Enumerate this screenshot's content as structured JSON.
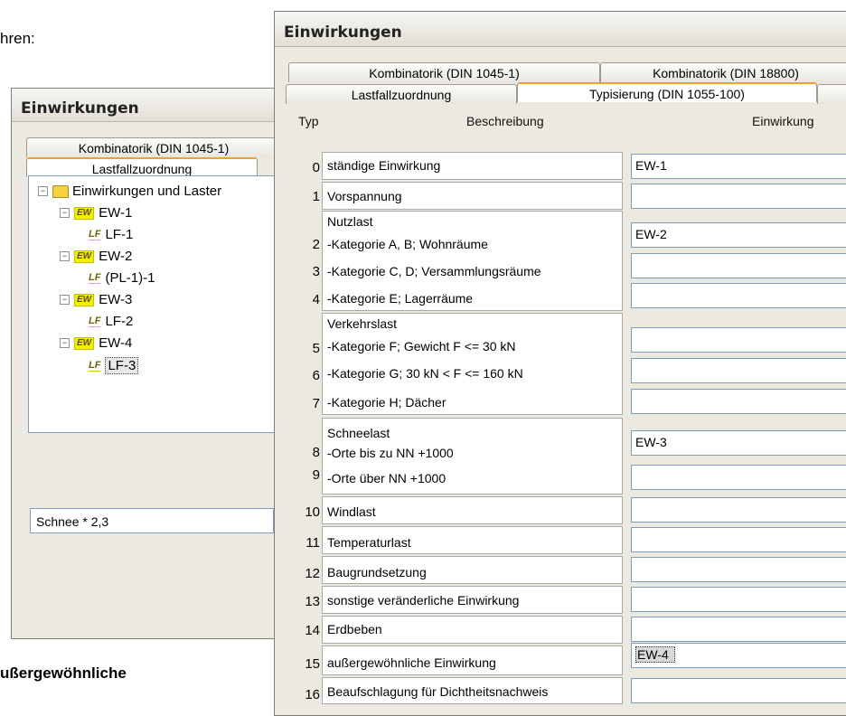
{
  "doc_fragments": {
    "top": "hren:",
    "bottom": "ußergewöhnliche"
  },
  "back_window": {
    "title": "Einwirkungen",
    "tabs": {
      "row1": "Kombinatorik (DIN 1045-1)",
      "row2": "Lastfallzuordnung"
    },
    "tree": {
      "root": "Einwirkungen und Laster",
      "nodes": [
        {
          "label": "EW-1",
          "children": [
            "LF-1"
          ]
        },
        {
          "label": "EW-2",
          "children": [
            "(PL-1)-1"
          ]
        },
        {
          "label": "EW-3",
          "children": [
            "LF-2"
          ]
        },
        {
          "label": "EW-4",
          "children": [
            "LF-3"
          ]
        }
      ],
      "icon_ew": "EW",
      "icon_lf": "LF"
    },
    "formula_input": "Schnee * 2,3"
  },
  "front_window": {
    "title": "Einwirkungen",
    "tabs": {
      "row1": [
        "Kombinatorik (DIN 1045-1)",
        "Kombinatorik (DIN 18800)"
      ],
      "row2": [
        "Lastfallzuordnung",
        "Typisierung (DIN 1055-100)"
      ]
    },
    "headers": {
      "typ": "Typ",
      "beschreibung": "Beschreibung",
      "einwirkung": "Einwirkung"
    },
    "rows": [
      {
        "typ": "0",
        "text": "ständige Einwirkung",
        "value": "EW-1"
      },
      {
        "typ": "1",
        "text": "Vorspannung",
        "value": ""
      },
      {
        "typ": "2",
        "text": "-Kategorie A, B; Wohnräume",
        "value": "EW-2"
      },
      {
        "typ": "3",
        "text": "-Kategorie C, D; Versammlungsräume",
        "value": ""
      },
      {
        "typ": "4",
        "text": "-Kategorie E; Lagerräume",
        "value": ""
      },
      {
        "typ": "5",
        "text": "-Kategorie F; Gewicht F <= 30 kN",
        "value": ""
      },
      {
        "typ": "6",
        "text": "-Kategorie G; 30 kN < F <= 160 kN",
        "value": ""
      },
      {
        "typ": "7",
        "text": "-Kategorie H; Dächer",
        "value": ""
      },
      {
        "typ": "8",
        "text": "-Orte bis zu NN +1000",
        "value": "EW-3"
      },
      {
        "typ": "9",
        "text": "-Orte über NN +1000",
        "value": ""
      },
      {
        "typ": "10",
        "text": "Windlast",
        "value": ""
      },
      {
        "typ": "11",
        "text": "Temperaturlast",
        "value": ""
      },
      {
        "typ": "12",
        "text": "Baugrundsetzung",
        "value": ""
      },
      {
        "typ": "13",
        "text": "sonstige veränderliche Einwirkung",
        "value": ""
      },
      {
        "typ": "14",
        "text": "Erdbeben",
        "value": ""
      },
      {
        "typ": "15",
        "text": "außergewöhnliche Einwirkung",
        "value": "EW-4"
      },
      {
        "typ": "16",
        "text": "Beaufschlagung für Dichtheitsnachweis",
        "value": ""
      }
    ],
    "group_titles": {
      "nutzlast": "Nutzlast",
      "verkehrslast": "Verkehrslast",
      "schneelast": "Schneelast"
    }
  },
  "colors": {
    "tab_accent": "#f0a030",
    "ew_icon": "#f4ee00",
    "folder": "#f5d23f"
  }
}
